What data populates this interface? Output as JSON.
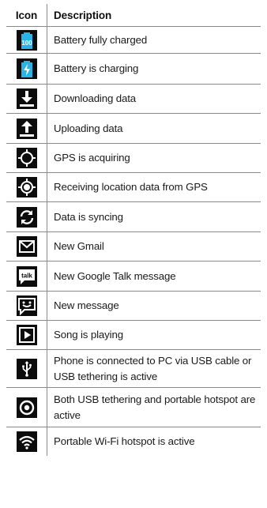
{
  "header": {
    "icon_label": "Icon",
    "description_label": "Description"
  },
  "rows": [
    {
      "icon": "battery-full-icon",
      "badge": "100",
      "description": "Battery fully charged"
    },
    {
      "icon": "battery-charging-icon",
      "description": "Battery is charging"
    },
    {
      "icon": "download-icon",
      "description": "Downloading data"
    },
    {
      "icon": "upload-icon",
      "description": "Uploading data"
    },
    {
      "icon": "gps-acquiring-icon",
      "description": "GPS is acquiring"
    },
    {
      "icon": "gps-location-icon",
      "description": "Receiving location data from GPS"
    },
    {
      "icon": "sync-icon",
      "description": "Data is syncing"
    },
    {
      "icon": "gmail-icon",
      "description": "New Gmail"
    },
    {
      "icon": "google-talk-icon",
      "badge": "talk",
      "description": "New Google Talk message"
    },
    {
      "icon": "message-icon",
      "description": "New message"
    },
    {
      "icon": "play-icon",
      "description": "Song is playing"
    },
    {
      "icon": "usb-icon",
      "description": "Phone is connected to PC via USB cable or USB tethering is active"
    },
    {
      "icon": "usb-hotspot-icon",
      "description": "Both USB tethering and portable hotspot are active"
    },
    {
      "icon": "wifi-hotspot-icon",
      "description": "Portable Wi-Fi hotspot is active"
    }
  ]
}
